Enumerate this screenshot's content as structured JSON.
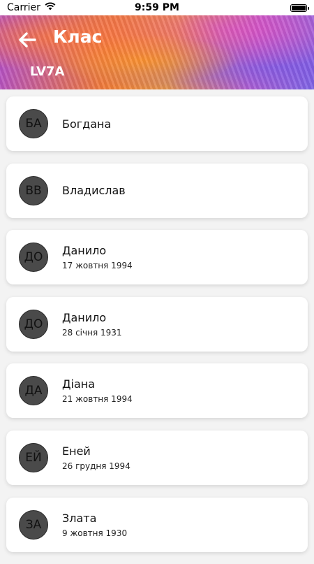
{
  "status_bar": {
    "carrier": "Carrier",
    "time": "9:59 PM"
  },
  "header": {
    "title": "Клас",
    "subtitle": "LV7A"
  },
  "students": [
    {
      "initials": "БА",
      "name": "Богдана",
      "date": ""
    },
    {
      "initials": "ВВ",
      "name": "Владислав",
      "date": ""
    },
    {
      "initials": "ДО",
      "name": "Данило",
      "date": "17 жовтня 1994"
    },
    {
      "initials": "ДО",
      "name": "Данило",
      "date": "28 січня 1931"
    },
    {
      "initials": "ДА",
      "name": "Діана",
      "date": "21 жовтня 1994"
    },
    {
      "initials": "ЕЙ",
      "name": "Еней",
      "date": "26 грудня 1994"
    },
    {
      "initials": "ЗА",
      "name": "Злата",
      "date": "9 жовтня 1930"
    }
  ]
}
